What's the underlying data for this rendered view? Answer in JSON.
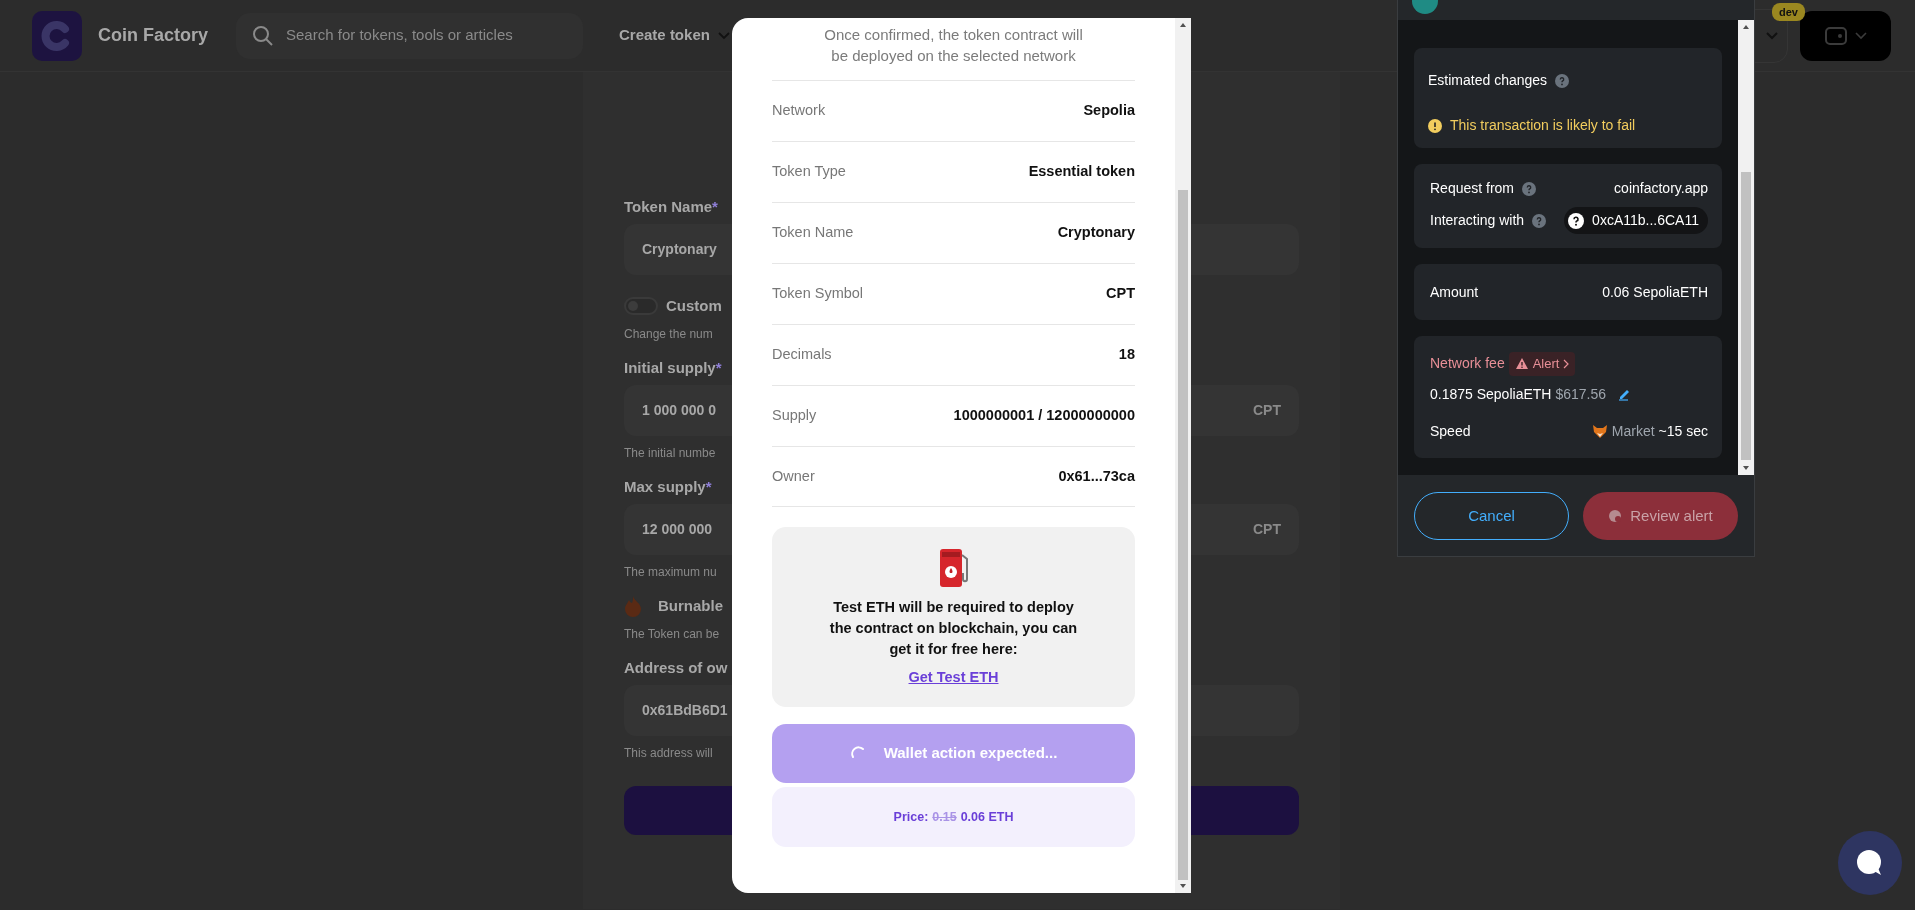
{
  "header": {
    "brand": "Coin Factory",
    "search": {
      "placeholder": "Search for tokens, tools or articles"
    },
    "nav": [
      {
        "label": "Create token"
      }
    ],
    "badge": "dev"
  },
  "form": {
    "items": [
      {
        "kind": "input",
        "label": "Token Name",
        "required_mark": "*",
        "value": "Cryptonary"
      },
      {
        "kind": "toggle",
        "label": "Custom",
        "on": false,
        "hint": "Change the num"
      },
      {
        "kind": "input",
        "label": "Initial supply",
        "required_mark": "*",
        "value": "1 000 000 0",
        "suffix": "CPT",
        "hint": "The initial numbe"
      },
      {
        "kind": "input",
        "label": "Max supply",
        "required_mark": "*",
        "value": "12 000 000",
        "suffix": "CPT",
        "hint": "The maximum nu"
      },
      {
        "kind": "feature",
        "label": "Burnable",
        "hint": "The Token can be"
      },
      {
        "kind": "input",
        "label": "Address of ow",
        "value": "0x61BdB6D1",
        "hint": "This address will"
      }
    ]
  },
  "modal": {
    "intro": "Once confirmed, the token contract will be deployed on the selected network",
    "rows": [
      {
        "label": "Network",
        "value": "Sepolia"
      },
      {
        "label": "Token Type",
        "value": "Essential token"
      },
      {
        "label": "Token Name",
        "value": "Cryptonary"
      },
      {
        "label": "Token Symbol",
        "value": "CPT"
      },
      {
        "label": "Decimals",
        "value": "18"
      },
      {
        "label": "Supply",
        "value": "1000000001 / 12000000000"
      },
      {
        "label": "Owner",
        "value": "0x61...73ca"
      }
    ],
    "notice": {
      "text": "Test ETH will be required to deploy the contract on blockchain, you can get it for free here:",
      "link": "Get Test ETH"
    },
    "action": {
      "label": "Wallet action expected...",
      "busy": true
    },
    "price": {
      "label": "Price:",
      "old": "0.15",
      "new": "0.06 ETH"
    }
  },
  "wallet_popup": {
    "estimated": {
      "label": "Estimated changes",
      "warning": "This transaction is likely to fail"
    },
    "request": [
      {
        "kind": "text",
        "label": "Request from",
        "value": "coinfactory.app"
      },
      {
        "kind": "address",
        "label": "Interacting with",
        "value": "0xcA11b...6CA11"
      }
    ],
    "amount": {
      "label": "Amount",
      "value": "0.06 SepoliaETH"
    },
    "fee": {
      "label": "Network fee",
      "alert": "Alert",
      "amount": "0.1875 SepoliaETH",
      "fiat": "$617.56",
      "speed_label": "Speed",
      "speed": "Market",
      "eta": "~15 sec"
    },
    "buttons": [
      {
        "label": "Cancel",
        "kind": "secondary"
      },
      {
        "label": "Review alert",
        "kind": "danger"
      }
    ]
  }
}
